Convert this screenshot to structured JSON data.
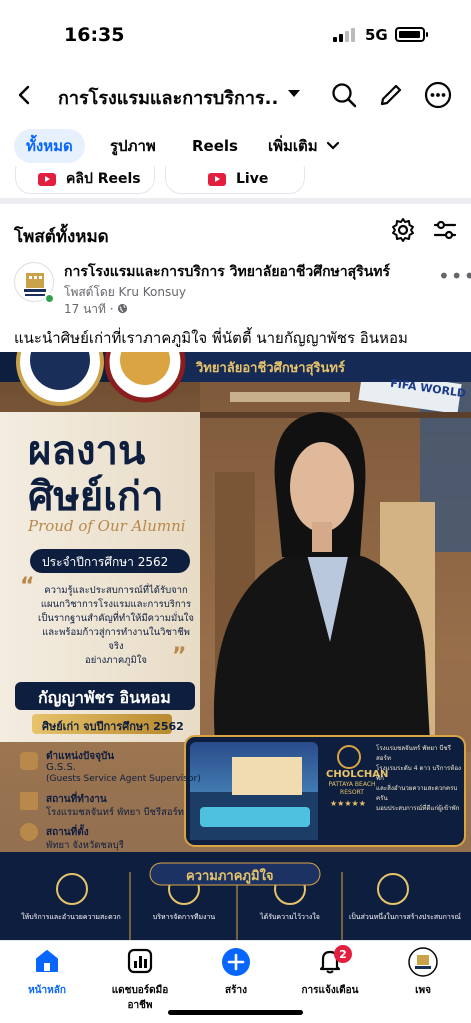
{
  "status_bar": {
    "time": "16:35",
    "network": "5G"
  },
  "header": {
    "title": "การโรงแรมและการบริการ..."
  },
  "tabs": [
    {
      "label": "ทั้งหมด",
      "active": true
    },
    {
      "label": "รูปภาพ",
      "active": false
    },
    {
      "label": "Reels",
      "active": false
    },
    {
      "label": "เพิ่มเติม",
      "active": false
    }
  ],
  "pills": [
    {
      "label": "คลิป Reels",
      "icon": "reels-icon"
    },
    {
      "label": "Live",
      "icon": "live-icon"
    }
  ],
  "section": {
    "title": "โพสต์ทั้งหมด"
  },
  "post": {
    "page_name": "การโรงแรมและการบริการ วิทยาลัยอาชีวศึกษาสุรินทร์",
    "posted_by": "โพสต์โดย Kru Konsuy",
    "time": "17 นาที",
    "text": "แนะนำศิษย์เก่าที่เราภาคภูมิใจ พี่นัตตี้ นายกัญญาพัชร อินหอม"
  },
  "poster": {
    "college": "วิทยาลัยอาชีวศึกษาสุรินทร์",
    "title_line1": "ผลงาน",
    "title_line2": "ศิษย์เก่า",
    "title_en": "Proud of Our Alumni",
    "academic_year": "ประจำปีการศึกษา 2562",
    "quote": [
      "ความรู้และประสบการณ์ที่ได้รับจาก",
      "แผนกวิชาการโรงแรมและการบริการ",
      "เป็นรากฐานสำคัญที่ทำให้มีความมั่นใจ",
      "และพร้อมก้าวสู่การทำงานในวิชาชีพจริง",
      "อย่างภาคภูมิใจ"
    ],
    "alumni_name": "กัญญาพัชร อินหอม",
    "graduated": "ศิษย์เก่า จบปีการศึกษา 2562",
    "position_label": "ตำแหน่งปัจจุบัน",
    "position": "G.S.S.",
    "position_full": "(Guests Service Agent Supervisor)",
    "workplace_label": "สถานที่ทำงาน",
    "workplace": "โรงแรมชลจันทร์ พัทยา บีชรีสอร์ท",
    "location_label": "สถานที่ตั้ง",
    "location": "พัทยา จังหวัดชลบุรี",
    "resort_brand": "CHOLCHAN",
    "resort_sub": "PATTAYA BEACH RESORT",
    "resort_stars": "★★★★★",
    "resort_desc": [
      "โรงแรมชลจันทร์ พัทยา บีชรีสอร์ท",
      "โรงแรมระดับ 4 ดาว บริการห้องพัก",
      "และสิ่งอำนวยความสะดวกครบครัน",
      "มอบประสบการณ์ที่ดีแก่ผู้เข้าพัก"
    ],
    "pride_heading": "ความภาคภูมิใจ",
    "pride_items": [
      "ให้บริการและอำนวยความสะดวก",
      "บริหารจัดการทีมงาน",
      "ได้รับความไว้วางใจ",
      "เป็นส่วนหนึ่งในการสร้างประสบการณ์"
    ],
    "sign": "FIFA WORLD"
  },
  "bottom_nav": [
    {
      "label": "หน้าหลัก",
      "icon": "home-icon",
      "active": true
    },
    {
      "label": "แดชบอร์ดมืออาชีพ",
      "icon": "dashboard-icon",
      "active": false
    },
    {
      "label": "สร้าง",
      "icon": "plus-icon",
      "active": false
    },
    {
      "label": "การแจ้งเตือน",
      "icon": "bell-icon",
      "active": false,
      "badge": "2"
    },
    {
      "label": "เพจ",
      "icon": "page-avatar-icon",
      "active": false
    }
  ],
  "colors": {
    "accent": "#0866ff",
    "navy": "#0e1e3f",
    "gold": "#d9a441"
  }
}
